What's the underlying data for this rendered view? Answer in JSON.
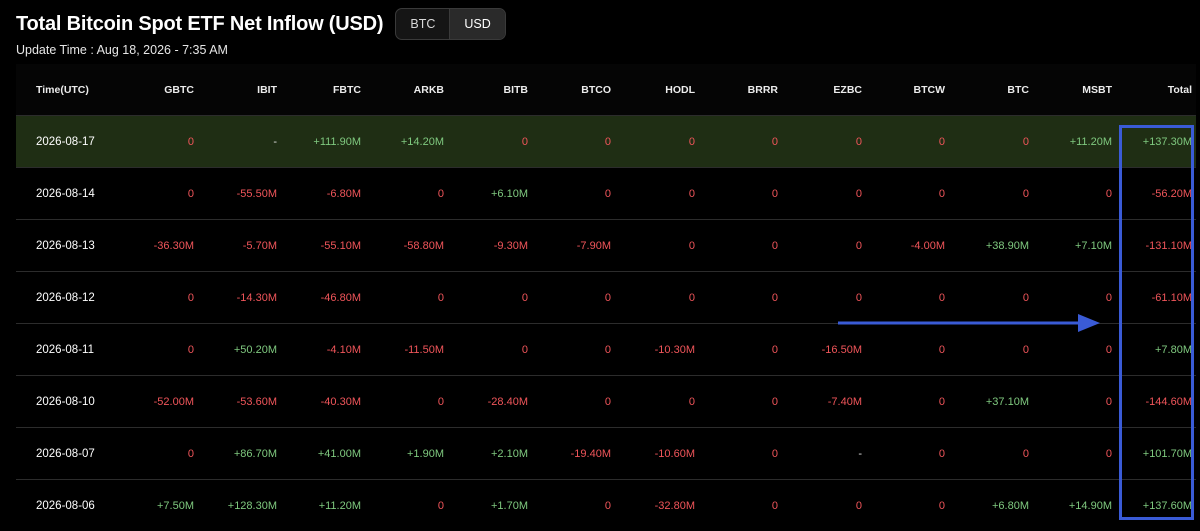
{
  "title": "Total Bitcoin Spot ETF Net Inflow (USD)",
  "toggle": {
    "btc": "BTC",
    "usd": "USD",
    "selected": "USD"
  },
  "update_time": "Update Time : Aug 18, 2026 - 7:35 AM",
  "columns": [
    "Time(UTC)",
    "GBTC",
    "IBIT",
    "FBTC",
    "ARKB",
    "BITB",
    "BTCO",
    "HODL",
    "BRRR",
    "EZBC",
    "BTCW",
    "BTC",
    "MSBT",
    "Total"
  ],
  "rows": [
    [
      "2026-08-17",
      "0",
      "-",
      "+111.90M",
      "+14.20M",
      "0",
      "0",
      "0",
      "0",
      "0",
      "0",
      "0",
      "+11.20M",
      "+137.30M"
    ],
    [
      "2026-08-14",
      "0",
      "-55.50M",
      "-6.80M",
      "0",
      "+6.10M",
      "0",
      "0",
      "0",
      "0",
      "0",
      "0",
      "0",
      "-56.20M"
    ],
    [
      "2026-08-13",
      "-36.30M",
      "-5.70M",
      "-55.10M",
      "-58.80M",
      "-9.30M",
      "-7.90M",
      "0",
      "0",
      "0",
      "-4.00M",
      "+38.90M",
      "+7.10M",
      "-131.10M"
    ],
    [
      "2026-08-12",
      "0",
      "-14.30M",
      "-46.80M",
      "0",
      "0",
      "0",
      "0",
      "0",
      "0",
      "0",
      "0",
      "0",
      "-61.10M"
    ],
    [
      "2026-08-11",
      "0",
      "+50.20M",
      "-4.10M",
      "-11.50M",
      "0",
      "0",
      "-10.30M",
      "0",
      "-16.50M",
      "0",
      "0",
      "0",
      "+7.80M"
    ],
    [
      "2026-08-10",
      "-52.00M",
      "-53.60M",
      "-40.30M",
      "0",
      "-28.40M",
      "0",
      "0",
      "0",
      "-7.40M",
      "0",
      "+37.10M",
      "0",
      "-144.60M"
    ],
    [
      "2026-08-07",
      "0",
      "+86.70M",
      "+41.00M",
      "+1.90M",
      "+2.10M",
      "-19.40M",
      "-10.60M",
      "0",
      "-",
      "0",
      "0",
      "0",
      "+101.70M"
    ],
    [
      "2026-08-06",
      "+7.50M",
      "+128.30M",
      "+11.20M",
      "0",
      "+1.70M",
      "0",
      "-32.80M",
      "0",
      "0",
      "0",
      "+6.80M",
      "+14.90M",
      "+137.60M"
    ]
  ],
  "highlight_row": 0,
  "colors": {
    "positive": "#7fc97f",
    "negative": "#f0555a",
    "highlight_row_bg": "#1f2e14",
    "annotation": "#3a5bd6"
  }
}
